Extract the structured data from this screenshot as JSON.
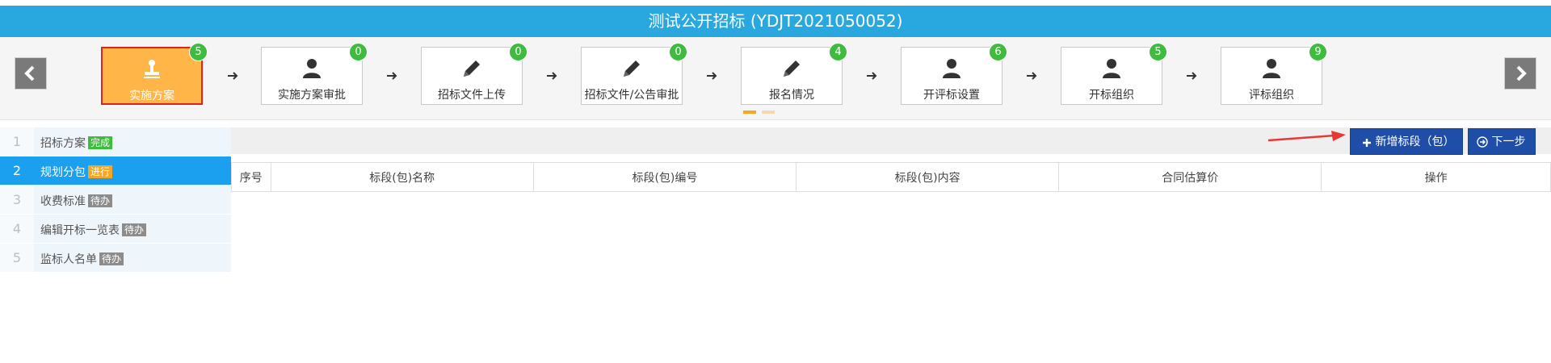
{
  "header": {
    "title": "测试公开招标 (YDJT2021050052)"
  },
  "steps": [
    {
      "label": "实施方案",
      "badge": "5",
      "icon": "stamp-icon",
      "active": true
    },
    {
      "label": "实施方案审批",
      "badge": "0",
      "icon": "user-icon"
    },
    {
      "label": "招标文件上传",
      "badge": "0",
      "icon": "pencil-icon"
    },
    {
      "label": "招标文件/公告审批",
      "badge": "0",
      "icon": "pencil-icon"
    },
    {
      "label": "报名情况",
      "badge": "4",
      "icon": "pencil-icon"
    },
    {
      "label": "开评标设置",
      "badge": "6",
      "icon": "user-icon"
    },
    {
      "label": "开标组织",
      "badge": "5",
      "icon": "user-icon"
    },
    {
      "label": "评标组织",
      "badge": "9",
      "icon": "user-icon"
    }
  ],
  "sidebar": {
    "items": [
      {
        "num": "1",
        "label": "招标方案",
        "status": "完成",
        "status_color": "#3fbb3f"
      },
      {
        "num": "2",
        "label": "规划分包",
        "status": "进行",
        "status_color": "#f5a623",
        "active": true
      },
      {
        "num": "3",
        "label": "收费标准",
        "status": "待办",
        "status_color": "#8c8c8c"
      },
      {
        "num": "4",
        "label": "编辑开标一览表",
        "status": "待办",
        "status_color": "#8c8c8c"
      },
      {
        "num": "5",
        "label": "监标人名单",
        "status": "待办",
        "status_color": "#8c8c8c"
      }
    ]
  },
  "toolbar": {
    "add_label": "新增标段（包）",
    "next_label": "下一步"
  },
  "table": {
    "headers": [
      "序号",
      "标段(包)名称",
      "标段(包)编号",
      "标段(包)内容",
      "合同估算价",
      "操作"
    ]
  },
  "colors": {
    "accent": "#29a8e0",
    "active_step": "#ffb548",
    "button": "#1f4ea8"
  }
}
